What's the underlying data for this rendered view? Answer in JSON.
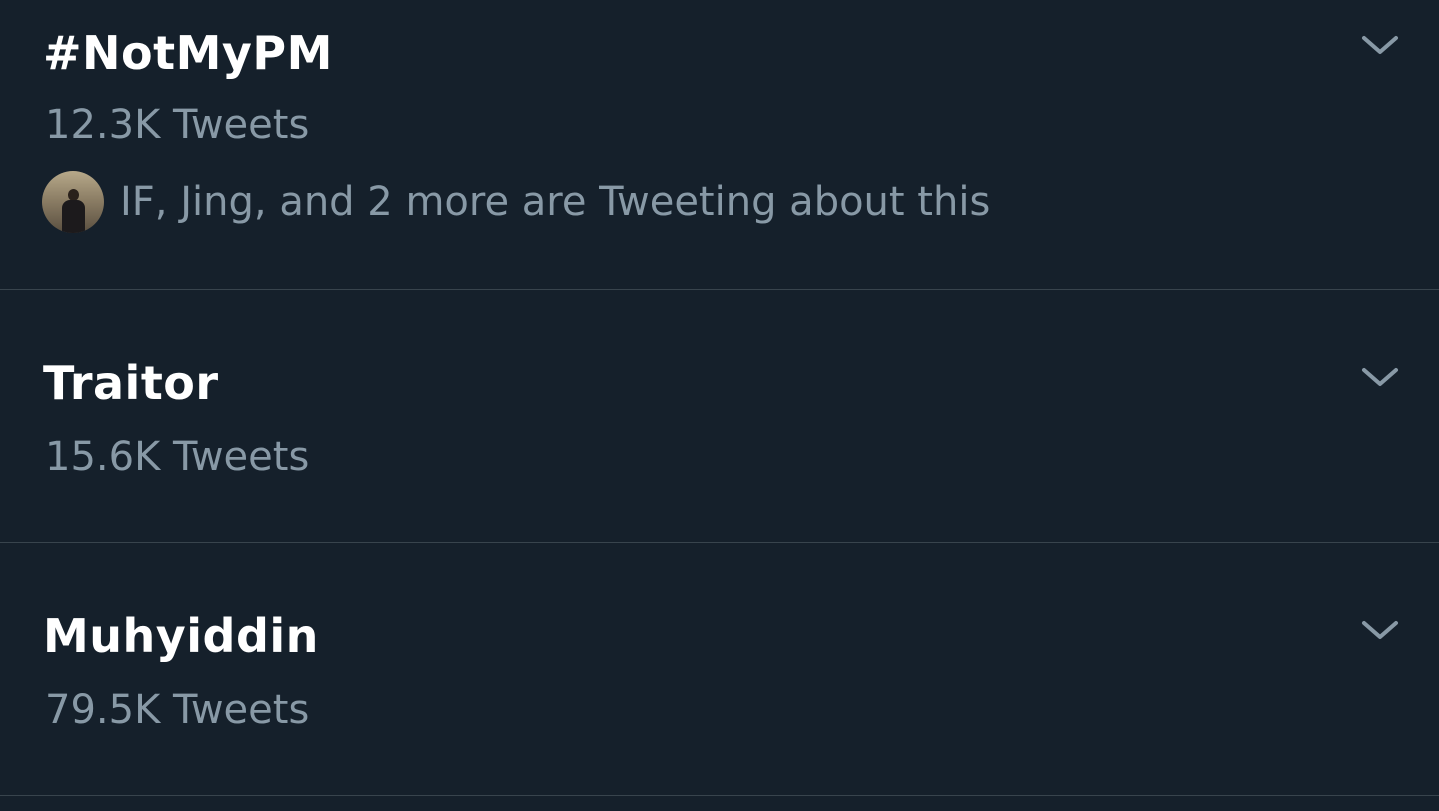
{
  "trends": [
    {
      "name": "#NotMyPM",
      "count": "12.3K Tweets",
      "context": "IF, Jing, and 2 more are Tweeting about this"
    },
    {
      "name": "Traitor",
      "count": "15.6K Tweets"
    },
    {
      "name": "Muhyiddin",
      "count": "79.5K Tweets"
    }
  ],
  "icons": {
    "more": "chevron-down-icon",
    "avatar": "avatar"
  },
  "colors": {
    "background": "#15202b",
    "primary_text": "#ffffff",
    "secondary_text": "#8899a6",
    "divider": "#38444d"
  }
}
